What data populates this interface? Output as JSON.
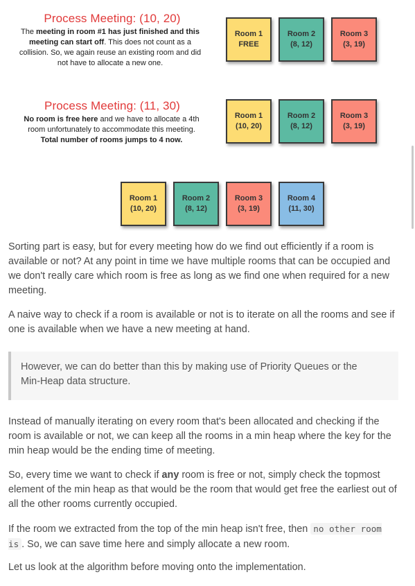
{
  "diagram": {
    "step1": {
      "title": "Process Meeting:  (10, 20)",
      "desc_parts": [
        "The ",
        "meeting in room #1 has just finished and this meeting can start off",
        ". This does not count as a collision. So, we again reuse an existing room and did not have to allocate a new one."
      ],
      "rooms": [
        {
          "label": "Room 1",
          "value": "FREE",
          "color": "#fddc73"
        },
        {
          "label": "Room 2",
          "value": "(8, 12)",
          "color": "#5cbaa2"
        },
        {
          "label": "Room 3",
          "value": "(3, 19)",
          "color": "#fb8a7a"
        }
      ]
    },
    "step2": {
      "title": "Process Meeting:  (11, 30)",
      "desc_parts": [
        "No room is free here",
        " and we have to allocate a 4th room unfortunately to accommodate this meeting. ",
        "Total number of rooms jumps to 4 now."
      ],
      "rooms": [
        {
          "label": "Room 1",
          "value": "(10, 20)",
          "color": "#fddc73"
        },
        {
          "label": "Room 2",
          "value": "(8, 12)",
          "color": "#5cbaa2"
        },
        {
          "label": "Room 3",
          "value": "(3, 19)",
          "color": "#fb8a7a"
        }
      ]
    },
    "final_rooms": [
      {
        "label": "Room 1",
        "value": "(10, 20)",
        "color": "#fddc73"
      },
      {
        "label": "Room 2",
        "value": "(8, 12)",
        "color": "#5cbaa2"
      },
      {
        "label": "Room 3",
        "value": "(3, 19)",
        "color": "#fb8a7a"
      },
      {
        "label": "Room 4",
        "value": "(11, 30)",
        "color": "#89bde5"
      }
    ]
  },
  "article": {
    "p1": "Sorting part is easy, but for every meeting how do we find out efficiently if a room is available or not? At any point in time we have multiple rooms that can be occupied and we don't really care which room is free as long as we find one when required for a new meeting.",
    "p2": "A naive way to check if a room is available or not is to iterate on all the rooms and see if one is available when we have a new meeting at hand.",
    "quote": "However, we can do better than this by making use of Priority Queues or the Min-Heap data structure.",
    "p3": "Instead of manually iterating on every room that's been allocated and checking if the room is available or not, we can keep all the rooms in a min heap where the key for the min heap would be the ending time of meeting.",
    "p4_before": "So, every time we want to check if ",
    "p4_bold": "any",
    "p4_after": " room is free or not, simply check the topmost element of the min heap as that would be the room that would get free the earliest out of all the other rooms currently occupied.",
    "p5_before": "If the room we extracted from the top of the min heap isn't free, then ",
    "p5_code": "no other room is",
    "p5_after": ". So, we can save time here and simply allocate a new room.",
    "p6": "Let us look at the algorithm before moving onto the implementation."
  }
}
